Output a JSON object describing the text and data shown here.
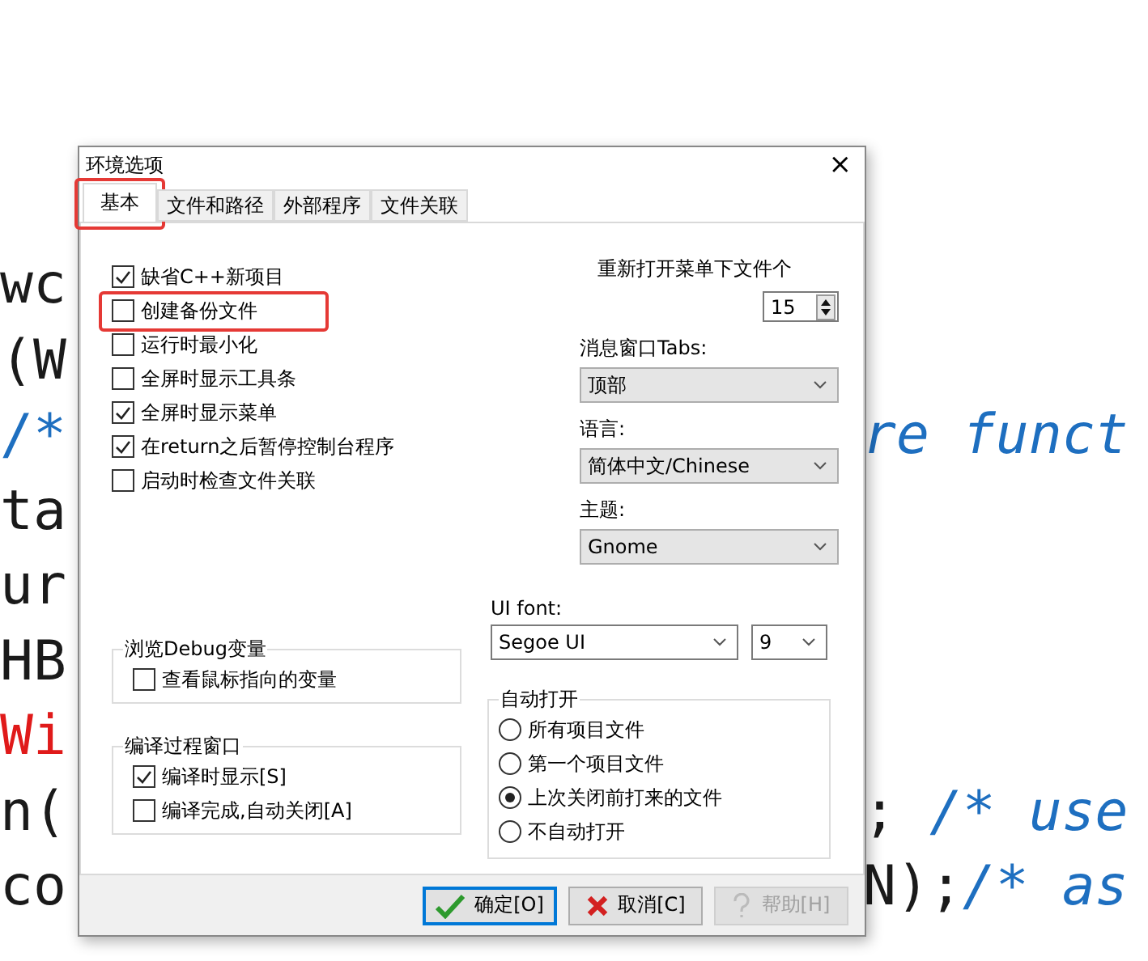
{
  "editor": {
    "lines": [
      {
        "left": [
          {
            "text": "wc",
            "color": "#1a1a1a"
          }
        ]
      },
      {
        "left": [
          {
            "text": "(W",
            "color": "#1a1a1a"
          }
        ]
      },
      {
        "left": [
          {
            "text": "/*",
            "color": "#1e6fc0"
          }
        ],
        "right": [
          {
            "text": "re funct",
            "color": "#1e6fc0"
          }
        ]
      },
      {
        "left": [
          {
            "text": "ta",
            "color": "#1a1a1a"
          }
        ]
      },
      {
        "left": [
          {
            "text": "ur",
            "color": "#1a1a1a"
          }
        ]
      },
      {
        "left": [
          {
            "text": "HB",
            "color": "#1a1a1a"
          }
        ]
      },
      {
        "left": [
          {
            "text": "Wi",
            "color": "#e01a1a"
          }
        ]
      },
      {
        "left": [
          {
            "text": "n(",
            "color": "#1a1a1a"
          }
        ],
        "right": [
          {
            "text": ";",
            "color": "#1a1a1a"
          },
          {
            "text": " /* use",
            "color": "#1e6fc0"
          }
        ]
      },
      {
        "left": [
          {
            "text": "co",
            "color": "#1a1a1a"
          }
        ],
        "right": [
          {
            "text": "N);",
            "color": "#1a1a1a"
          },
          {
            "text": "/* as",
            "color": "#1e6fc0"
          }
        ]
      }
    ]
  },
  "dialog": {
    "title": "环境选项",
    "close": "×",
    "tabs": [
      {
        "label": "基本",
        "selected": true,
        "highlighted": true
      },
      {
        "label": "文件和路径",
        "selected": false,
        "highlighted": false
      },
      {
        "label": "外部程序",
        "selected": false,
        "highlighted": false
      },
      {
        "label": "文件关联",
        "selected": false,
        "highlighted": false
      }
    ],
    "options": [
      {
        "label": "缺省C++新项目",
        "checked": true,
        "highlighted": false
      },
      {
        "label": "创建备份文件",
        "checked": false,
        "highlighted": true
      },
      {
        "label": "运行时最小化",
        "checked": false,
        "highlighted": false
      },
      {
        "label": "全屏时显示工具条",
        "checked": false,
        "highlighted": false
      },
      {
        "label": "全屏时显示菜单",
        "checked": true,
        "highlighted": false
      },
      {
        "label": "在return之后暂停控制台程序",
        "checked": true,
        "highlighted": false
      },
      {
        "label": "启动时检查文件关联",
        "checked": false,
        "highlighted": false
      }
    ],
    "recent": {
      "label": "重新打开菜单下文件个",
      "value": "15"
    },
    "selects": [
      {
        "label": "消息窗口Tabs:",
        "value": "顶部"
      },
      {
        "label": "语言:",
        "value": "简体中文/Chinese"
      },
      {
        "label": "主题:",
        "value": "Gnome"
      }
    ],
    "ui_font": {
      "label": "UI font:",
      "font": "Segoe UI",
      "size": "9"
    },
    "debug_group": {
      "title": "浏览Debug变量",
      "options": [
        {
          "label": "查看鼠标指向的变量",
          "checked": false
        }
      ]
    },
    "compile_group": {
      "title": "编译过程窗口",
      "options": [
        {
          "label": "编译时显示[S]",
          "checked": true
        },
        {
          "label": "编译完成,自动关闭[A]",
          "checked": false
        }
      ]
    },
    "auto_open": {
      "title": "自动打开",
      "options": [
        {
          "label": "所有项目文件",
          "selected": false
        },
        {
          "label": "第一个项目文件",
          "selected": false
        },
        {
          "label": "上次关闭前打来的文件",
          "selected": true
        },
        {
          "label": "不自动打开",
          "selected": false
        }
      ]
    },
    "buttons": [
      {
        "label": "确定[O]",
        "kind": "ok",
        "disabled": false,
        "default": true
      },
      {
        "label": "取消[C]",
        "kind": "cancel",
        "disabled": false,
        "default": false
      },
      {
        "label": "帮助[H]",
        "kind": "help",
        "disabled": true,
        "default": false
      }
    ]
  }
}
